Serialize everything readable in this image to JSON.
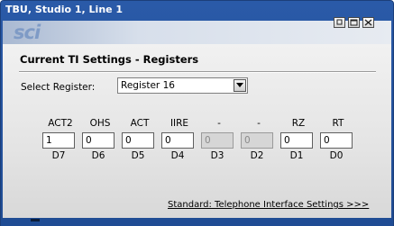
{
  "window": {
    "title": "TBU, Studio 1, Line 1"
  },
  "logo": {
    "text": "sci"
  },
  "panel": {
    "heading": "Current TI Settings - Registers",
    "select_label": "Select Register:",
    "select_value": "Register 16"
  },
  "registers": [
    {
      "name": "ACT2",
      "value": "1",
      "bit": "D7",
      "enabled": true
    },
    {
      "name": "OHS",
      "value": "0",
      "bit": "D6",
      "enabled": true
    },
    {
      "name": "ACT",
      "value": "0",
      "bit": "D5",
      "enabled": true
    },
    {
      "name": "IIRE",
      "value": "0",
      "bit": "D4",
      "enabled": true
    },
    {
      "name": "-",
      "value": "0",
      "bit": "D3",
      "enabled": false
    },
    {
      "name": "-",
      "value": "0",
      "bit": "D2",
      "enabled": false
    },
    {
      "name": "RZ",
      "value": "0",
      "bit": "D1",
      "enabled": true
    },
    {
      "name": "RT",
      "value": "0",
      "bit": "D0",
      "enabled": true
    }
  ],
  "footer": {
    "link": "Standard: Telephone Interface Settings >>>"
  }
}
